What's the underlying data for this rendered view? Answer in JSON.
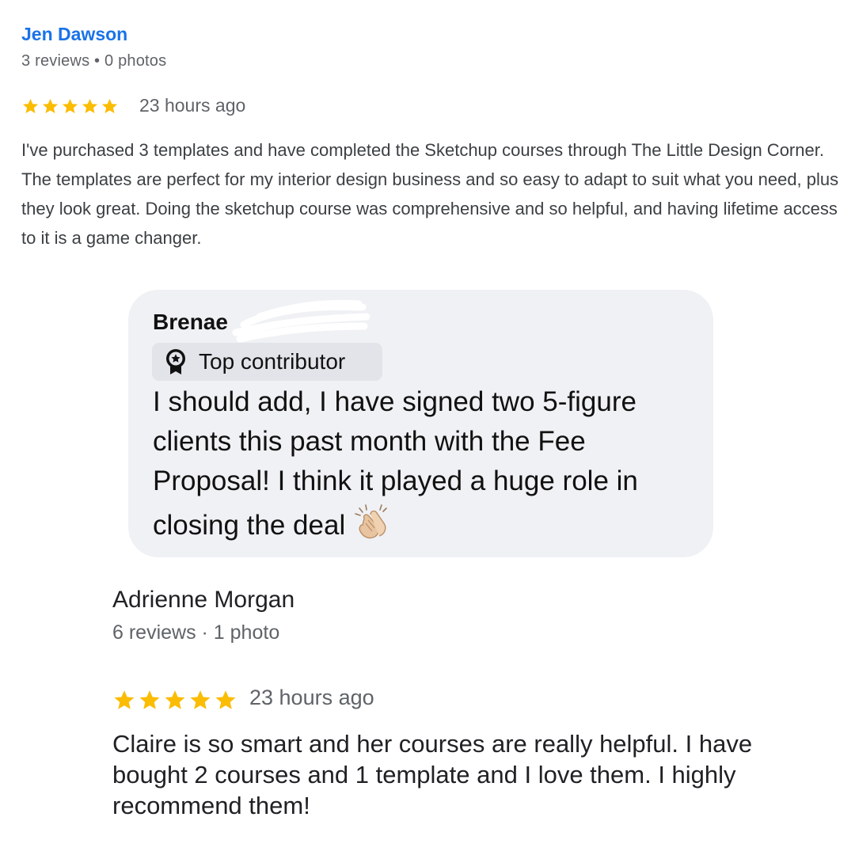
{
  "review1": {
    "author": "Jen Dawson",
    "meta": "3 reviews • 0 photos",
    "rating": 5,
    "time": "23 hours ago",
    "body": "I've purchased 3 templates and have completed the Sketchup courses through The Little Design Corner. The templates are perfect for my interior design business and so easy to adapt to suit what you need, plus they look great. Doing the sketchup course was comprehensive and so helpful, and having lifetime access to it is a game changer."
  },
  "comment": {
    "author": "Brenae",
    "badge": "Top contributor",
    "body": "I should add, I have signed two 5-figure clients this past month with the Fee Proposal! I think it played a huge role in closing the deal",
    "emoji": "clapping-hands-emoji"
  },
  "review2": {
    "author": "Adrienne Morgan",
    "meta": "6 reviews · 1 photo",
    "rating": 5,
    "time": "23 hours ago",
    "body": "Claire is so smart and her courses are really helpful. I have bought 2 courses and 1 template and I love them. I highly recommend them!"
  },
  "colors": {
    "author_link": "#1a73e8",
    "star": "#fbbc04",
    "meta_text": "#5f6368",
    "bubble_bg": "#f0f1f4",
    "badge_bg": "#e2e4e9"
  },
  "icons": {
    "star": "star-icon",
    "badge": "top-contributor-badge-icon"
  }
}
